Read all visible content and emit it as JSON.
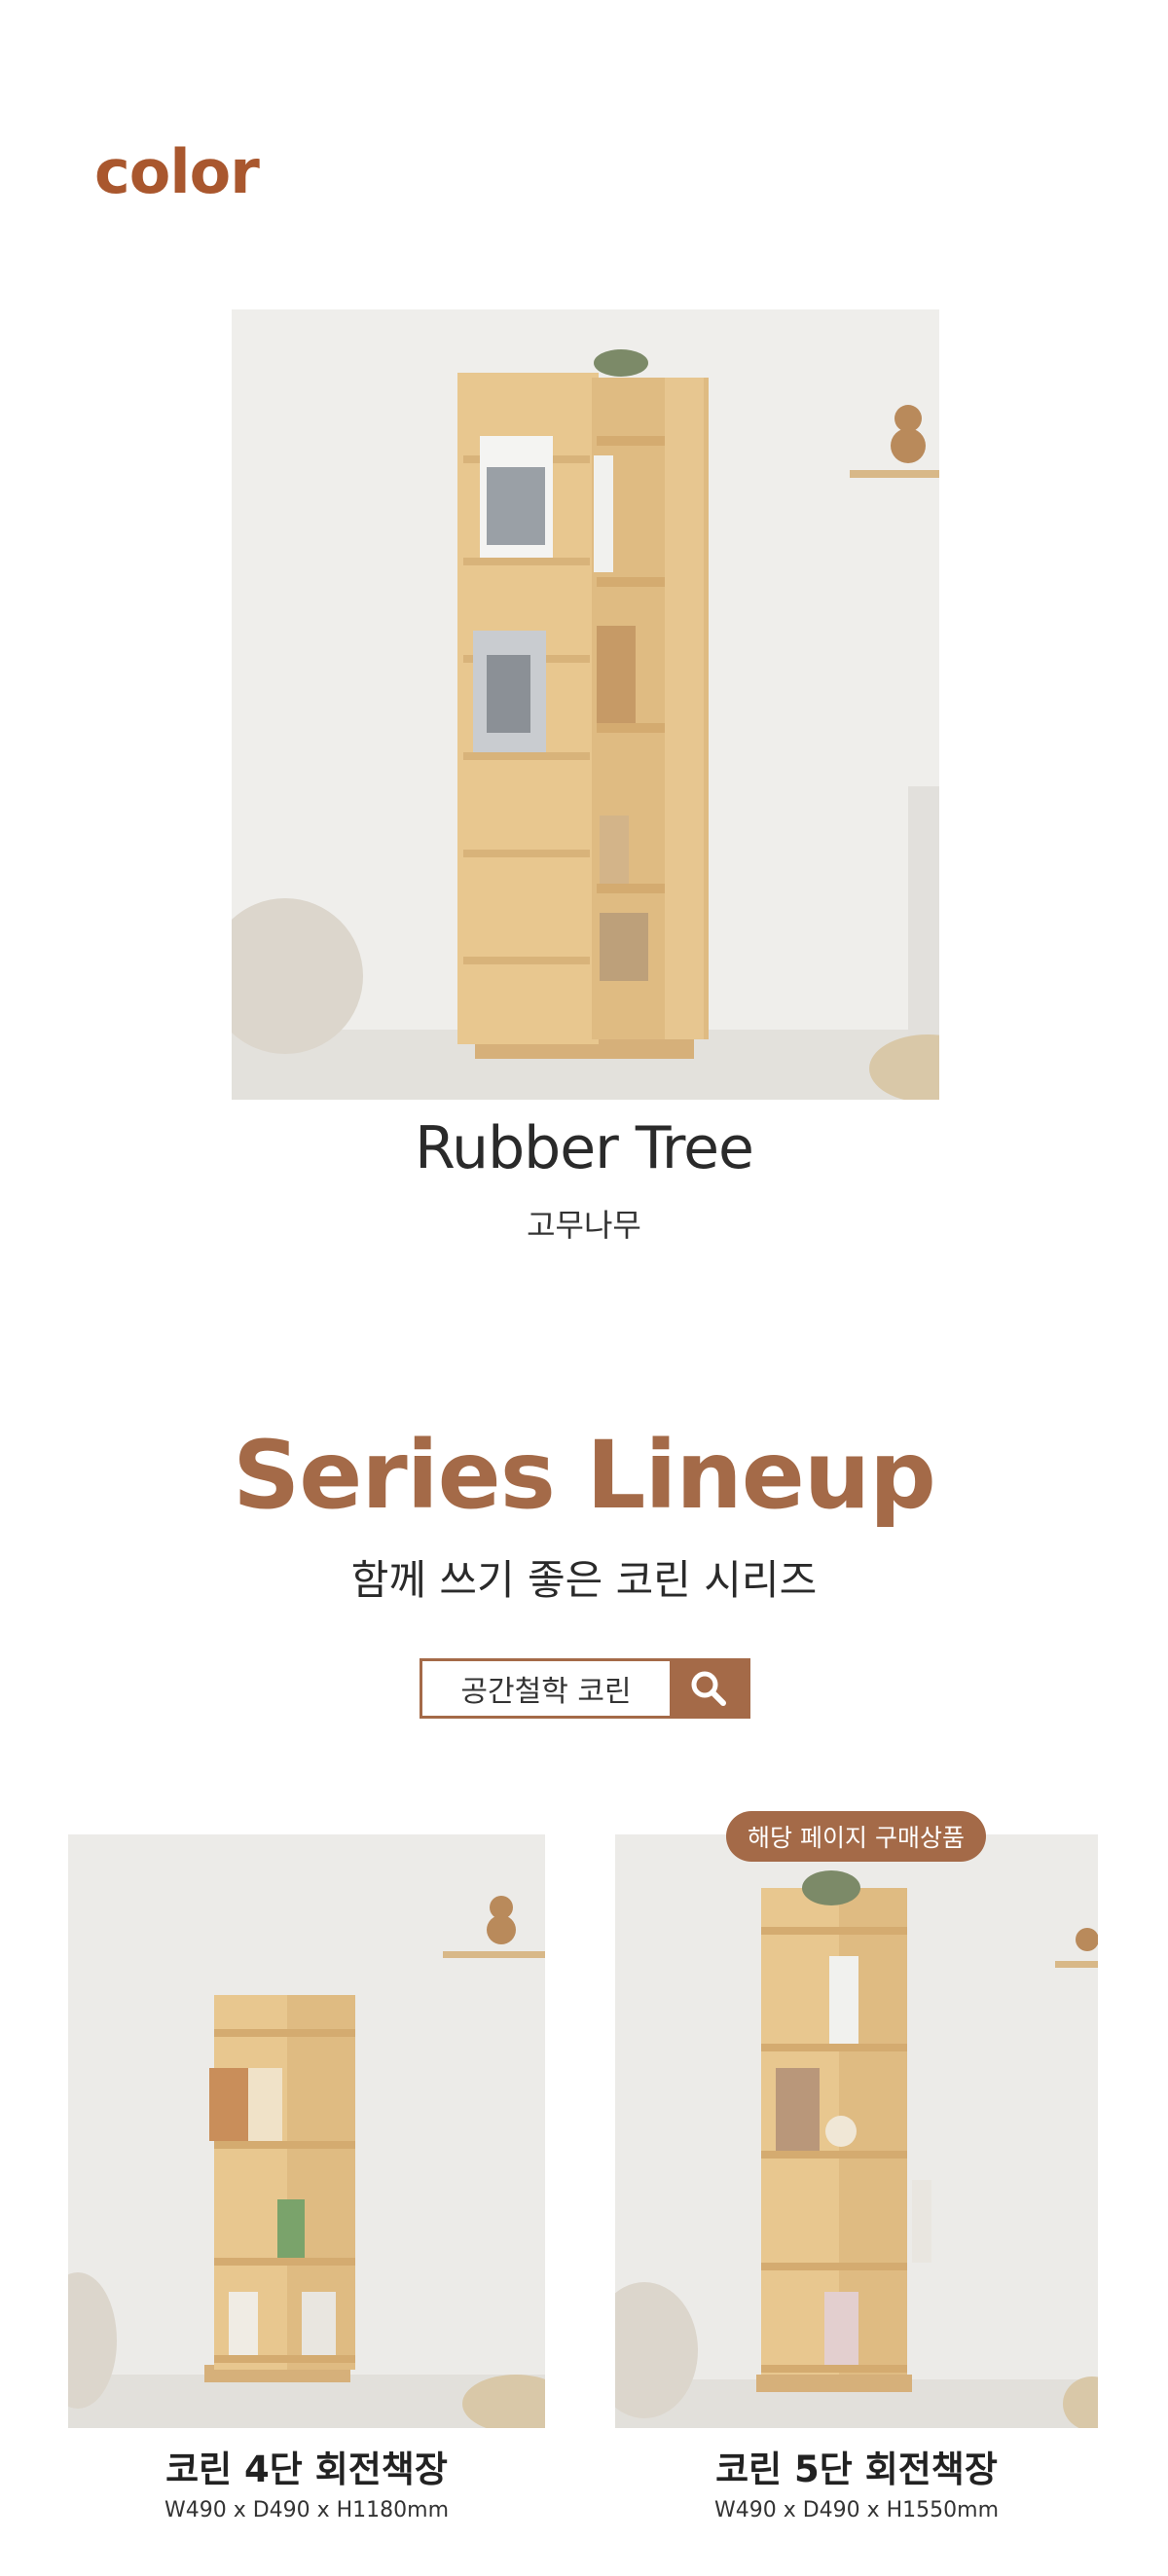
{
  "color_section": {
    "heading": "color",
    "swatch_name": "Rubber Tree",
    "swatch_name_ko": "고무나무"
  },
  "series_section": {
    "title": "Series Lineup",
    "subtitle": "함께 쓰기 좋은 코린 시리즈",
    "search": {
      "text": "공간철학 코린",
      "icon": "search-icon"
    }
  },
  "lineup": [
    {
      "name": "코린 4단 회전책장",
      "dimensions": "W490 x D490 x H1180mm"
    },
    {
      "badge": "해당 페이지 구매상품",
      "name": "코린 5단 회전책장",
      "dimensions": "W490 x D490 x H1550mm"
    }
  ],
  "colors": {
    "accent": "#a46a48",
    "heading_accent": "#a9572e",
    "wood": "#e6c38c"
  }
}
